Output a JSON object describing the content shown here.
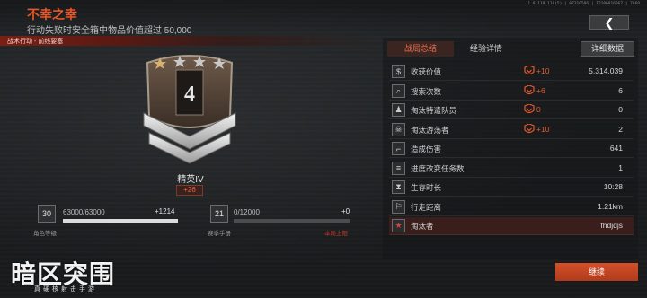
{
  "header": {
    "title": "不幸之幸",
    "subtitle": "行动失败时安全箱中物品价值超过 50,000",
    "version": "1.0.118.118(5) | 07310506 | 12106816067 | 7869",
    "back_icon": "chevron-left-icon"
  },
  "mode": {
    "label": "战术行动 - 前线要塞"
  },
  "rank": {
    "number": "4",
    "name": "精英IV",
    "delta": "+26",
    "stars": 3
  },
  "character_level": {
    "level": "30",
    "progress": "63000/63000",
    "gain": "+1214",
    "fill": 1.0,
    "label": "角色等级"
  },
  "season_manual": {
    "level": "21",
    "progress": "0/12000",
    "gain": "+0",
    "fill": 0.0,
    "label": "赛季手册",
    "status": "本局上限"
  },
  "tabs": {
    "summary": "战局总结",
    "exp_detail": "经验详情",
    "detail_data": "详细数据"
  },
  "stats": [
    {
      "icon": "dollar-icon",
      "label": "收获价值",
      "bonus": "+10",
      "value": "5,314,039"
    },
    {
      "icon": "search-icon",
      "label": "搜索次数",
      "bonus": "+6",
      "value": "6"
    },
    {
      "icon": "soldier-icon",
      "label": "淘汰特遣队员",
      "bonus": "0",
      "value": "0"
    },
    {
      "icon": "skull-icon",
      "label": "淘汰游荡者",
      "bonus": "+10",
      "value": "2"
    },
    {
      "icon": "gun-icon",
      "label": "造成伤害",
      "bonus": "",
      "value": "641"
    },
    {
      "icon": "list-icon",
      "label": "进度改变任务数",
      "bonus": "",
      "value": "1"
    },
    {
      "icon": "hourglass-icon",
      "label": "生存时长",
      "bonus": "",
      "value": "10:28"
    },
    {
      "icon": "running-icon",
      "label": "行走距离",
      "bonus": "",
      "value": "1.21km"
    },
    {
      "icon": "star-icon",
      "label": "淘汰者",
      "bonus": "",
      "value": "fhdjdjs"
    }
  ],
  "continue_label": "继续",
  "logo": {
    "title": "暗区突围",
    "subtitle": "真硬核射击手游"
  },
  "colors": {
    "accent": "#e8562a",
    "highlight_row": "#3a1e1c"
  }
}
